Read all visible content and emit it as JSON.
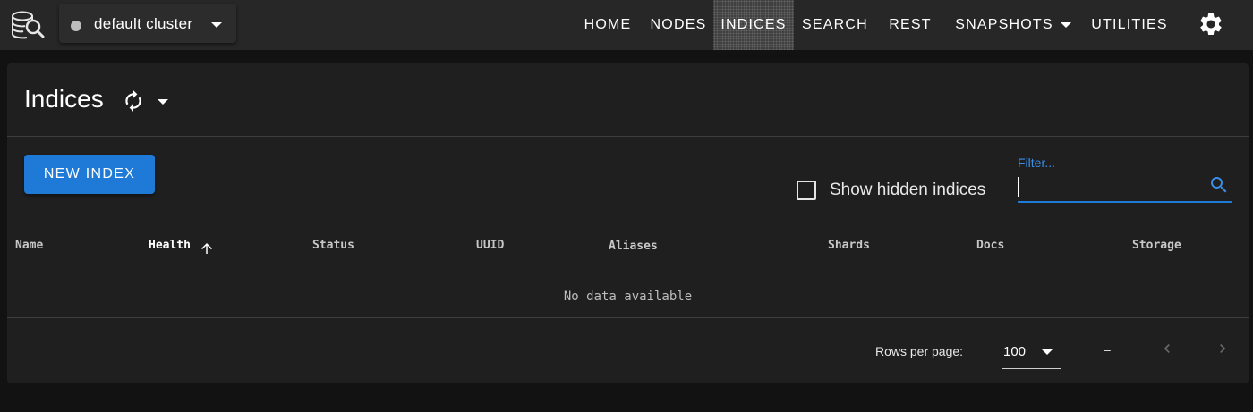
{
  "appbar": {
    "cluster": {
      "name": "default cluster",
      "status_color": "#bdbdbd"
    },
    "nav": [
      {
        "label": "HOME"
      },
      {
        "label": "NODES"
      },
      {
        "label": "INDICES"
      },
      {
        "label": "SEARCH"
      },
      {
        "label": "REST"
      },
      {
        "label": "SNAPSHOTS"
      },
      {
        "label": "UTILITIES"
      }
    ],
    "icons": {
      "logo": "elasticvue-logo-icon",
      "settings": "gear-icon"
    }
  },
  "page": {
    "title": "Indices",
    "new_index_label": "NEW INDEX",
    "show_hidden_label": "Show hidden indices",
    "show_hidden_checked": false,
    "filter": {
      "label": "Filter...",
      "value": ""
    }
  },
  "table": {
    "headers": [
      "Name",
      "Health",
      "Status",
      "UUID",
      "Aliases",
      "Shards",
      "Docs",
      "Storage"
    ],
    "sorted_column": "Health",
    "sort_direction": "ascending",
    "empty_text": "No data available"
  },
  "footer": {
    "rows_per_page_label": "Rows per page:",
    "rows_per_page_value": "100",
    "range_text": "–"
  },
  "colors": {
    "accent": "#1e7ad6",
    "appbar": "#272727",
    "card": "#1f1f1f",
    "background": "#121212"
  }
}
